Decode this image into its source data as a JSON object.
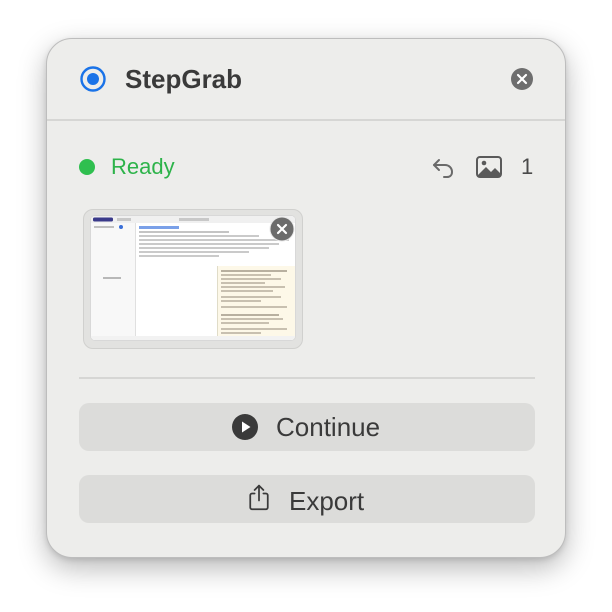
{
  "app": {
    "title": "StepGrab",
    "icon": "record-target-icon"
  },
  "status": {
    "label": "Ready",
    "color": "#2fbf4f"
  },
  "toolbar": {
    "undo_icon": "undo-icon",
    "images_icon": "photo-icon",
    "image_count": "1"
  },
  "captures": [
    {
      "type": "screenshot-thumbnail"
    }
  ],
  "actions": {
    "continue_label": "Continue",
    "export_label": "Export"
  },
  "colors": {
    "accent": "#1a73e8",
    "panel": "#ededeb",
    "button": "#dcdcda"
  }
}
